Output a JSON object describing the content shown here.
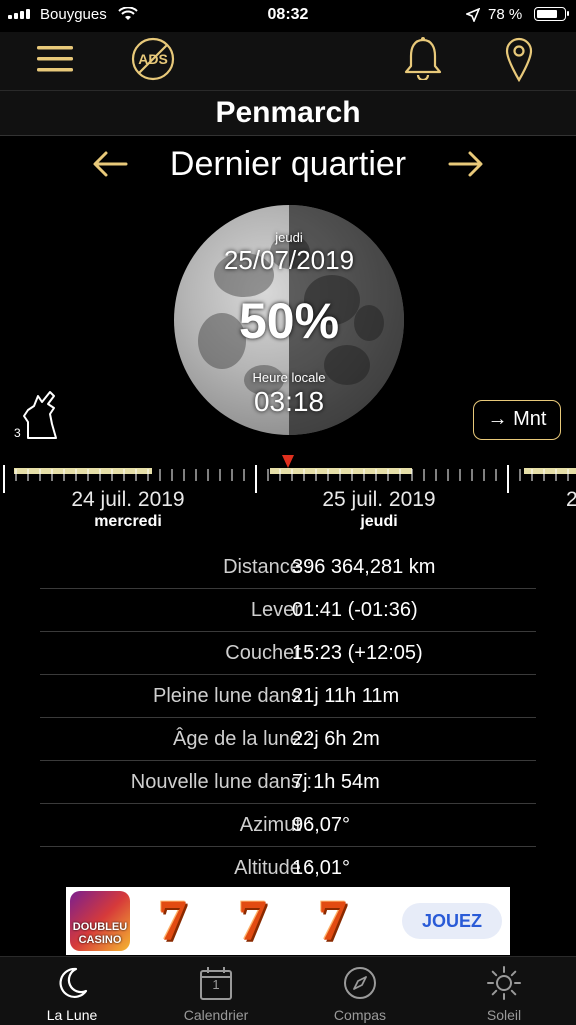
{
  "status_bar": {
    "carrier": "Bouygues",
    "time": "08:32",
    "battery": "78 %",
    "battery_level": 0.78
  },
  "toolbar": {
    "menu_icon": "hamburger-icon",
    "no_ads_icon": "no-ads-icon",
    "no_ads_text": "ADS",
    "bell_icon": "bell-icon",
    "location_icon": "map-pin-icon"
  },
  "location": "Penmarch",
  "phase": {
    "name": "Dernier quartier",
    "prev_icon": "arrow-left-icon",
    "next_icon": "arrow-right-icon"
  },
  "moon": {
    "weekday": "jeudi",
    "date": "25/07/2019",
    "illumination": "50%",
    "local_time_label": "Heure locale",
    "local_time": "03:18"
  },
  "wolf_badge": "3",
  "now_button": "→ Mnt",
  "timeline": {
    "days": [
      {
        "date": "24 juil. 2019",
        "weekday": "mercredi"
      },
      {
        "date": "25 juil. 2019",
        "weekday": "jeudi"
      },
      {
        "date": "2"
      }
    ]
  },
  "details": [
    {
      "label": "Distance :",
      "value": "396 364,281 km"
    },
    {
      "label": "Lever :",
      "value": "01:41 (-01:36)"
    },
    {
      "label": "Coucher :",
      "value": "15:23 (+12:05)"
    },
    {
      "label": "Pleine lune dans :",
      "value": "21j 11h 11m"
    },
    {
      "label": "Âge de la lune :",
      "value": "22j 6h 2m"
    },
    {
      "label": "Nouvelle lune dans :",
      "value": "7j 1h 54m"
    },
    {
      "label": "Azimut :",
      "value": "96,07°"
    },
    {
      "label": "Altitude :",
      "value": "16,01°"
    }
  ],
  "ad": {
    "logo_line1": "DOUBLEU",
    "logo_line2": "CASINO",
    "sevens": [
      "7",
      "7",
      "7"
    ],
    "cta": "JOUEZ"
  },
  "tabs": [
    {
      "label": "La Lune",
      "icon": "moon-icon",
      "active": true
    },
    {
      "label": "Calendrier",
      "icon": "calendar-icon",
      "badge": "1"
    },
    {
      "label": "Compas",
      "icon": "compass-icon"
    },
    {
      "label": "Soleil",
      "icon": "sun-icon"
    }
  ],
  "colors": {
    "accent": "#e8c97a",
    "marker": "#e0301e",
    "background": "#000000"
  }
}
